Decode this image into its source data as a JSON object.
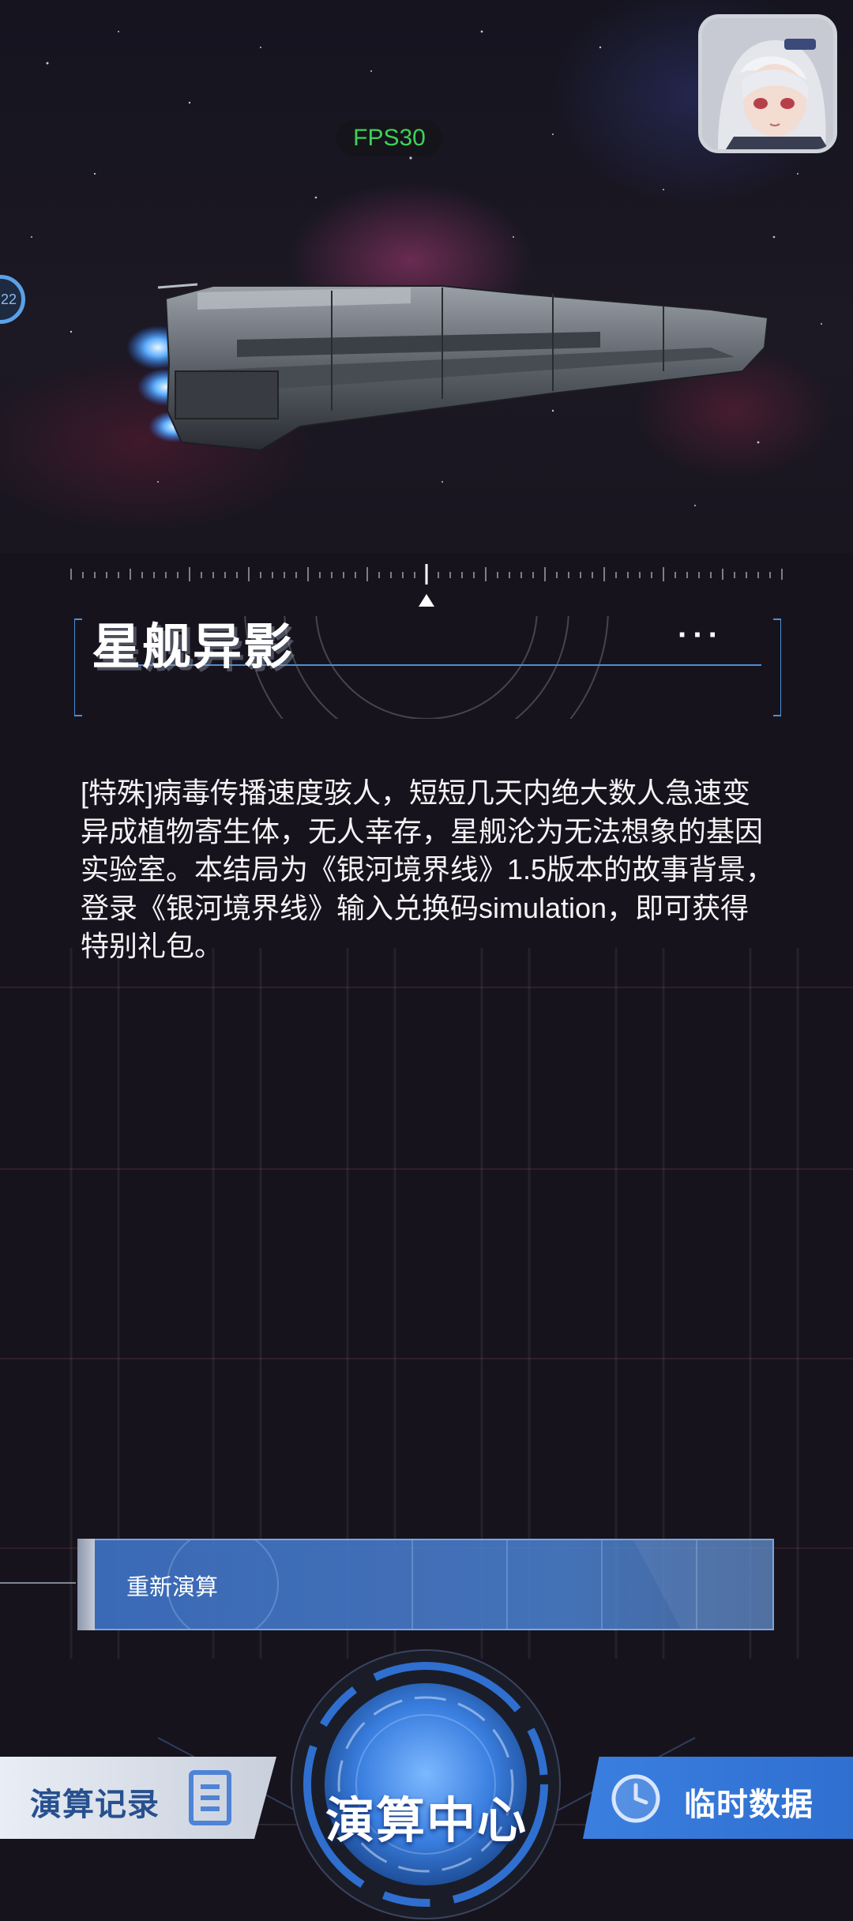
{
  "hud": {
    "fps": "FPS30",
    "side_badge": "22"
  },
  "story": {
    "title": "星舰异影",
    "more": "···",
    "description": "[特殊]病毒传播速度骇人，短短几天内绝大数人急速变异成植物寄生体，无人幸存，星舰沦为无法想象的基因实验室。本结局为《银河境界线》1.5版本的故事背景，登录《银河境界线》输入兑换码simulation，即可获得特别礼包。"
  },
  "actions": {
    "replay": "重新演算"
  },
  "nav": {
    "left": {
      "label": "演算记录",
      "icon": "list-document-icon"
    },
    "center": {
      "label": "演算中心"
    },
    "right": {
      "label": "临时数据",
      "icon": "clock-icon"
    }
  },
  "colors": {
    "accent": "#3a7fe0",
    "fps": "#3fd15a",
    "frame": "#4a8fd6"
  }
}
